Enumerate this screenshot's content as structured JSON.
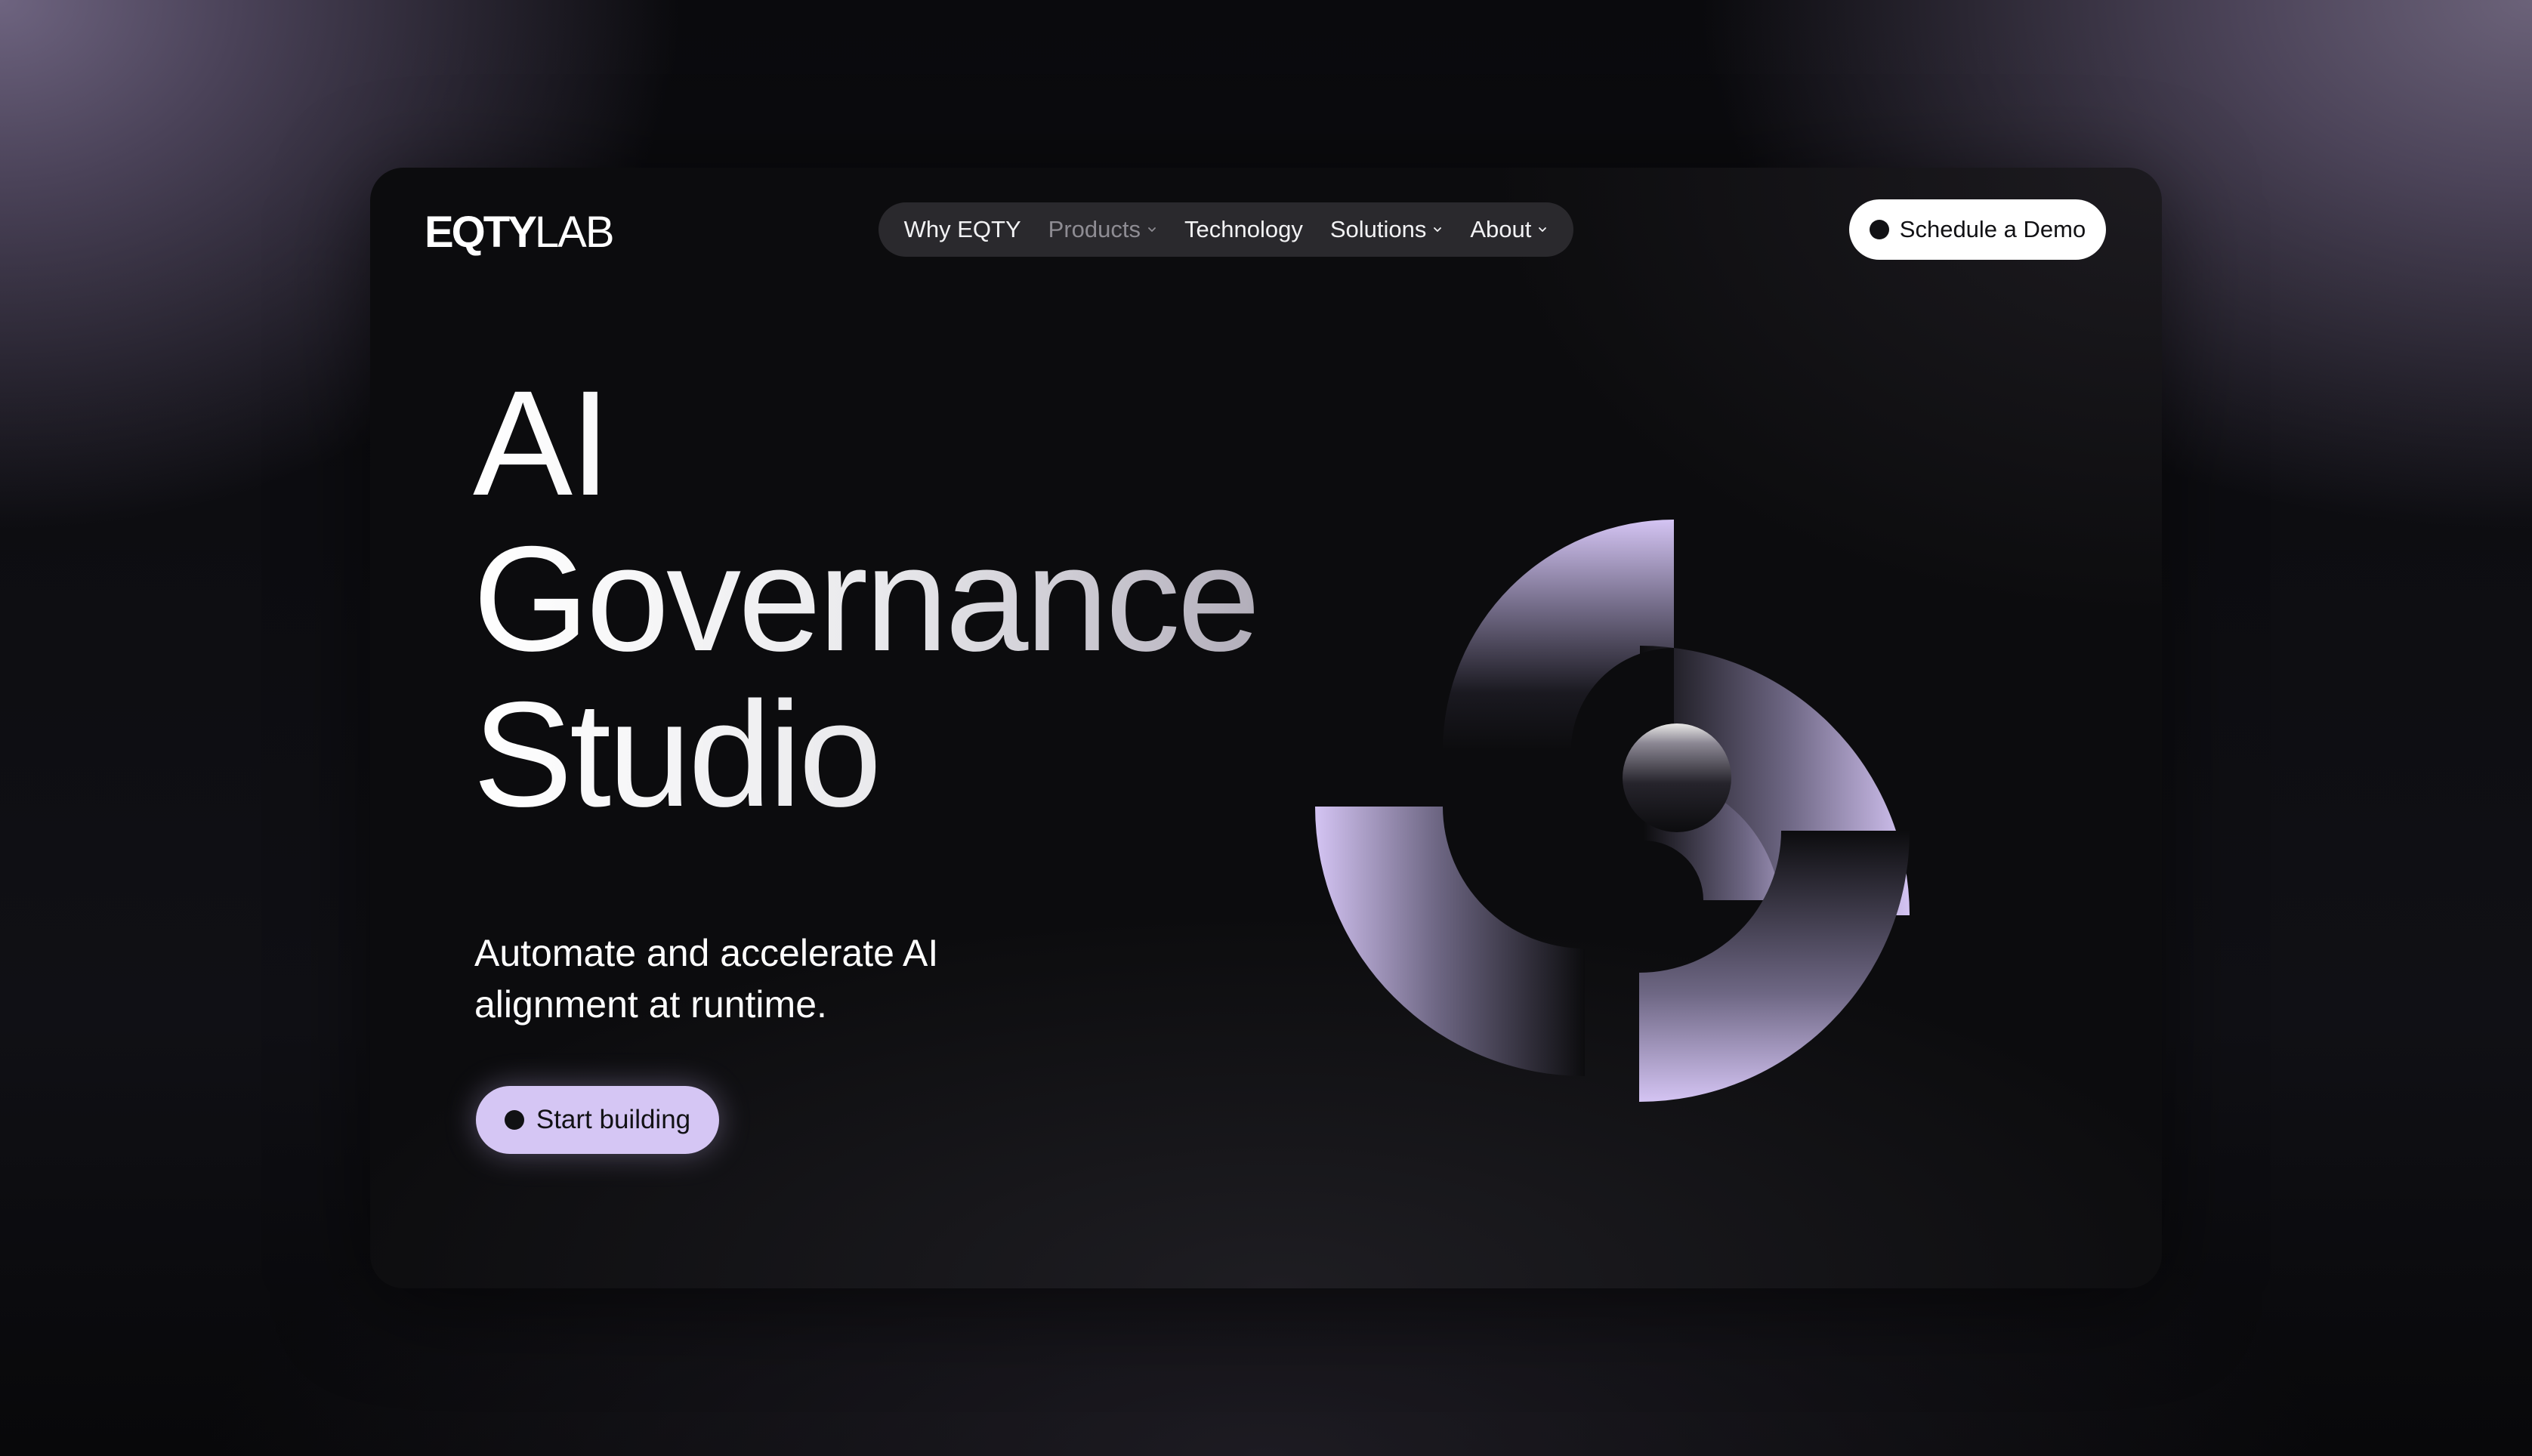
{
  "brand": {
    "logo_bold": "EQTY",
    "logo_light": "LAB"
  },
  "nav": {
    "items": [
      {
        "label": "Why EQTY",
        "has_dropdown": false,
        "dim": false
      },
      {
        "label": "Products",
        "has_dropdown": true,
        "dim": true
      },
      {
        "label": "Technology",
        "has_dropdown": false,
        "dim": false
      },
      {
        "label": "Solutions",
        "has_dropdown": true,
        "dim": false
      },
      {
        "label": "About",
        "has_dropdown": true,
        "dim": false
      }
    ]
  },
  "header_cta": {
    "label": "Schedule a Demo"
  },
  "hero": {
    "headline_lines": [
      "AI",
      "Governance",
      "Studio"
    ],
    "subtitle": "Automate and accelerate AI alignment at runtime.",
    "cta_label": "Start building"
  },
  "colors": {
    "accent": "#d5c6f4",
    "card_background": "#0c0c0e",
    "nav_background": "#2a292d",
    "graphic_lavender": "#d4c4f3"
  },
  "icons": {
    "chevron": "chevron-down-icon",
    "bullet": "dot-icon"
  }
}
